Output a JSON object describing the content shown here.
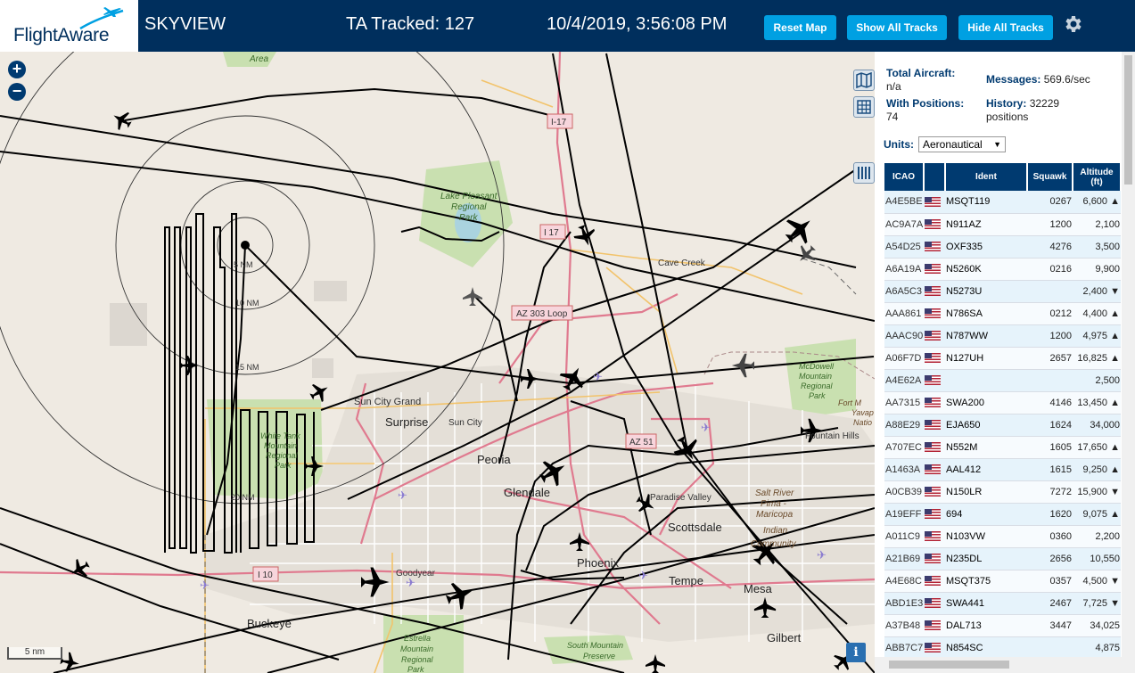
{
  "header": {
    "logo_text": "FlightAware",
    "app_title": "SKYVIEW",
    "ta_tracked": "TA Tracked: 127",
    "datetime": "10/4/2019, 3:56:08 PM",
    "reset_map": "Reset Map",
    "show_all_tracks": "Show All Tracks",
    "hide_all_tracks": "Hide All Tracks"
  },
  "map": {
    "zoom_in": "+",
    "zoom_out": "−",
    "scale": "5 nm",
    "info": "i",
    "labels": {
      "area": "Area",
      "i17_a": "I-17",
      "i17_b": "I 17",
      "lake1": "Lake Pleasant",
      "lake2": "Regional",
      "lake3": "Park",
      "cave_creek": "Cave Creek",
      "az303": "AZ 303 Loop",
      "sun_city_grand": "Sun City Grand",
      "surprise": "Surprise",
      "sun_city": "Sun City",
      "white_tank1": "White Tank",
      "white_tank2": "Mountain",
      "white_tank3": "Regional",
      "white_tank4": "Park",
      "peoria": "Peoria",
      "glendale": "Glendale",
      "az51": "AZ 51",
      "paradise_valley": "Paradise Valley",
      "scottsdale": "Scottsdale",
      "phoenix": "Phoenix",
      "tempe": "Tempe",
      "mesa": "Mesa",
      "gilbert": "Gilbert",
      "goodyear": "Goodyear",
      "buckeye": "Buckeye",
      "i10": "I 10",
      "mcdowell1": "McDowell",
      "mcdowell2": "Mountain",
      "mcdowell3": "Regional",
      "mcdowell4": "Park",
      "salt1": "Salt River",
      "salt2": "Pima -",
      "salt3": "Maricopa",
      "salt4": "Indian",
      "salt5": "Community",
      "fountain": "Fountain Hills",
      "fort1": "Fort M",
      "fort2": "Yavap",
      "fort3": "Natio",
      "estrella1": "Estrella",
      "estrella2": "Mountain",
      "estrella3": "Regional",
      "estrella4": "Park",
      "south_mtn1": "South Mountain",
      "south_mtn2": "Preserve",
      "ring_5": "5 NM",
      "ring_10": "10 NM",
      "ring_15": "15 NM",
      "ring_20": "20 NM"
    }
  },
  "sidebar": {
    "total_aircraft_label": "Total Aircraft:",
    "total_aircraft_value": "n/a",
    "with_positions_label": "With Positions:",
    "with_positions_value": "74",
    "messages_label": "Messages:",
    "messages_value": "569.6/sec",
    "history_label": "History:",
    "history_value": "32229",
    "history_unit": "positions",
    "units_label": "Units:",
    "units_value": "Aeronautical",
    "columns": [
      "ICAO",
      "",
      "Ident",
      "Squawk",
      "Altitude (ft)"
    ],
    "rows": [
      {
        "icao": "A4E5BE",
        "ident": "MSQT119",
        "squawk": "0267",
        "alt": "6,600",
        "trend": "▲"
      },
      {
        "icao": "AC9A7A",
        "ident": "N911AZ",
        "squawk": "1200",
        "alt": "2,100",
        "trend": ""
      },
      {
        "icao": "A54D25",
        "ident": "OXF335",
        "squawk": "4276",
        "alt": "3,500",
        "trend": ""
      },
      {
        "icao": "A6A19A",
        "ident": "N5260K",
        "squawk": "0216",
        "alt": "9,900",
        "trend": ""
      },
      {
        "icao": "A6A5C3",
        "ident": "N5273U",
        "squawk": "",
        "alt": "2,400",
        "trend": "▼"
      },
      {
        "icao": "AAA861",
        "ident": "N786SA",
        "squawk": "0212",
        "alt": "4,400",
        "trend": "▲"
      },
      {
        "icao": "AAAC90",
        "ident": "N787WW",
        "squawk": "1200",
        "alt": "4,975",
        "trend": "▲"
      },
      {
        "icao": "A06F7D",
        "ident": "N127UH",
        "squawk": "2657",
        "alt": "16,825",
        "trend": "▲"
      },
      {
        "icao": "A4E62A",
        "ident": "",
        "squawk": "",
        "alt": "2,500",
        "trend": ""
      },
      {
        "icao": "AA7315",
        "ident": "SWA200",
        "squawk": "4146",
        "alt": "13,450",
        "trend": "▲"
      },
      {
        "icao": "A88E29",
        "ident": "EJA650",
        "squawk": "1624",
        "alt": "34,000",
        "trend": ""
      },
      {
        "icao": "A707EC",
        "ident": "N552M",
        "squawk": "1605",
        "alt": "17,650",
        "trend": "▲"
      },
      {
        "icao": "A1463A",
        "ident": "AAL412",
        "squawk": "1615",
        "alt": "9,250",
        "trend": "▲"
      },
      {
        "icao": "A0CB39",
        "ident": "N150LR",
        "squawk": "7272",
        "alt": "15,900",
        "trend": "▼"
      },
      {
        "icao": "A19EFF",
        "ident": "694",
        "squawk": "1620",
        "alt": "9,075",
        "trend": "▲"
      },
      {
        "icao": "A011C9",
        "ident": "N103VW",
        "squawk": "0360",
        "alt": "2,200",
        "trend": ""
      },
      {
        "icao": "A21B69",
        "ident": "N235DL",
        "squawk": "2656",
        "alt": "10,550",
        "trend": ""
      },
      {
        "icao": "A4E68C",
        "ident": "MSQT375",
        "squawk": "0357",
        "alt": "4,500",
        "trend": "▼"
      },
      {
        "icao": "ABD1E3",
        "ident": "SWA441",
        "squawk": "2467",
        "alt": "7,725",
        "trend": "▼"
      },
      {
        "icao": "A37B48",
        "ident": "DAL713",
        "squawk": "3447",
        "alt": "34,025",
        "trend": ""
      },
      {
        "icao": "ABB7C7",
        "ident": "N854SC",
        "squawk": "",
        "alt": "4,875",
        "trend": ""
      }
    ]
  },
  "colors": {
    "header_bg": "#002f5d",
    "button_bg": "#00a0e2",
    "map_bg": "#efeae2",
    "table_header_bg": "#003a70",
    "row_odd_bg": "#e6f3fb",
    "road_major": "#e07a8f",
    "road_minor": "#f2c36b",
    "park_green": "#c9e0b0",
    "water": "#aad3df",
    "track": "#000000"
  },
  "icons": [
    "flightaware-logo-plane",
    "gear-icon",
    "zoom-in-icon",
    "zoom-out-icon",
    "map-layers-icon",
    "grid-icon",
    "columns-icon",
    "info-icon",
    "us-flag-icon",
    "aircraft-icon",
    "receiver-icon"
  ]
}
